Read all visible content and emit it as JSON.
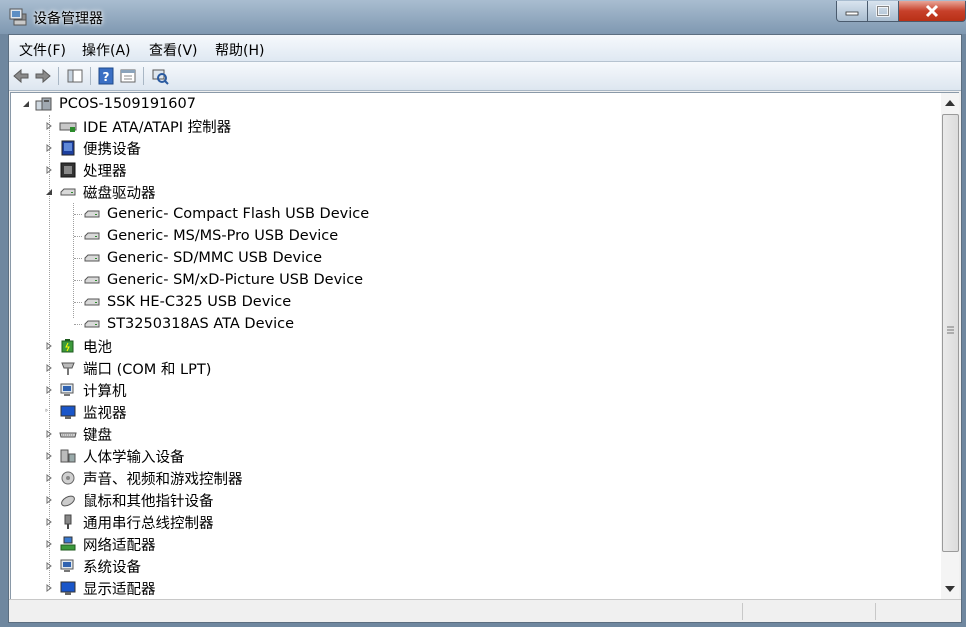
{
  "window": {
    "title": "设备管理器"
  },
  "menu": [
    {
      "label": "文件(F)"
    },
    {
      "label": "操作(A)"
    },
    {
      "label": "查看(V)"
    },
    {
      "label": "帮助(H)"
    }
  ],
  "toolbar": {
    "buttons": [
      "back-arrow-icon",
      "forward-arrow-icon",
      "show-hide-console-tree-icon",
      "help-icon",
      "properties-icon",
      "scan-hardware-icon"
    ]
  },
  "tree": {
    "root": {
      "label": "PCOS-1509191607",
      "expanded": true
    },
    "categories": [
      {
        "label": "IDE ATA/ATAPI 控制器",
        "expanded": false
      },
      {
        "label": "便携设备",
        "expanded": false
      },
      {
        "label": "处理器",
        "expanded": false
      },
      {
        "label": "磁盘驱动器",
        "expanded": true,
        "children": [
          {
            "label": "Generic- Compact Flash USB Device"
          },
          {
            "label": "Generic- MS/MS-Pro USB Device"
          },
          {
            "label": "Generic- SD/MMC USB Device"
          },
          {
            "label": "Generic- SM/xD-Picture USB Device"
          },
          {
            "label": "SSK HE-C325 USB Device"
          },
          {
            "label": "ST3250318AS ATA Device"
          }
        ]
      },
      {
        "label": "电池",
        "expanded": false
      },
      {
        "label": "端口 (COM 和 LPT)",
        "expanded": false
      },
      {
        "label": "计算机",
        "expanded": false
      },
      {
        "label": "监视器",
        "expanded": false
      },
      {
        "label": "键盘",
        "expanded": false
      },
      {
        "label": "人体学输入设备",
        "expanded": false
      },
      {
        "label": "声音、视频和游戏控制器",
        "expanded": false
      },
      {
        "label": "鼠标和其他指针设备",
        "expanded": false
      },
      {
        "label": "通用串行总线控制器",
        "expanded": false
      },
      {
        "label": "网络适配器",
        "expanded": false
      },
      {
        "label": "系统设备",
        "expanded": false
      },
      {
        "label": "显示适配器",
        "expanded": false
      }
    ]
  },
  "colors": {
    "titlebar": "#8aa3bb",
    "close": "#c7402a",
    "tree_bg": "#ffffff"
  }
}
